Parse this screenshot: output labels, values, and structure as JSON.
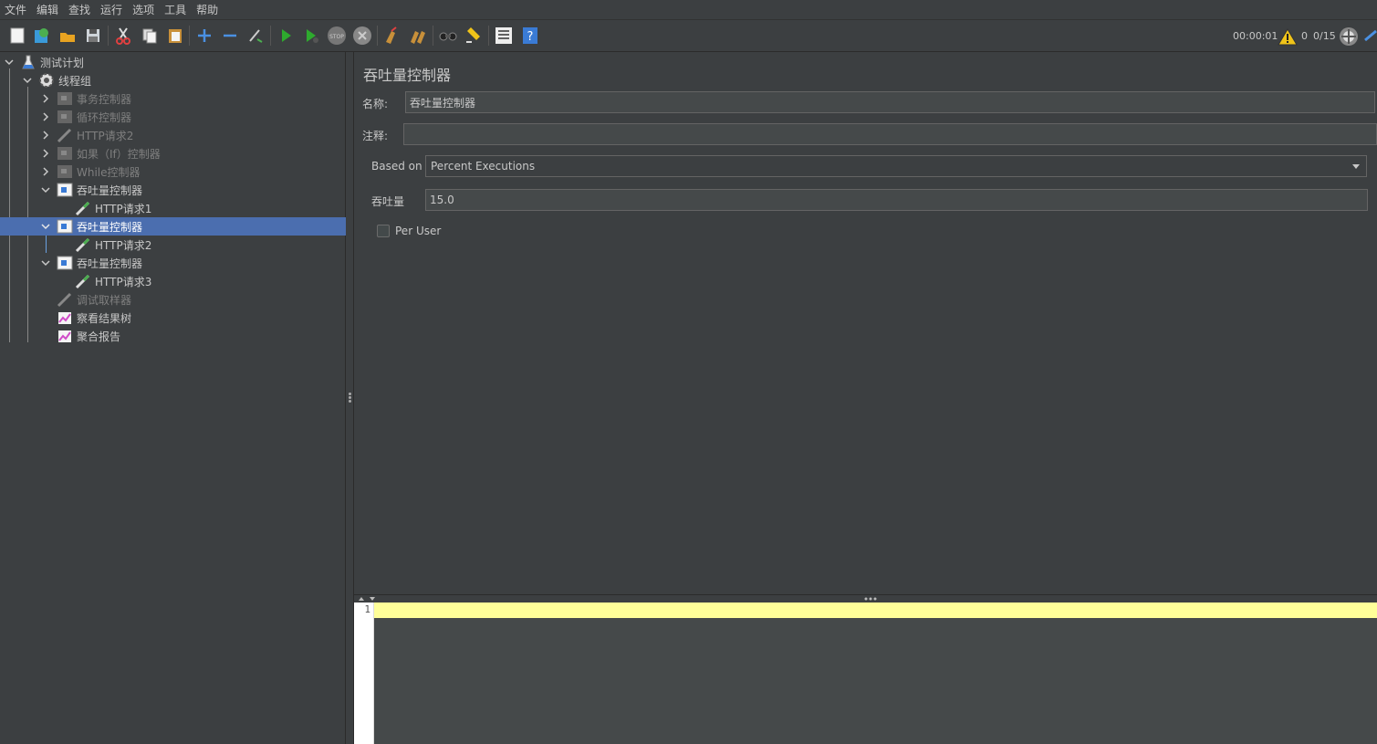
{
  "menu": [
    "文件",
    "编辑",
    "查找",
    "运行",
    "选项",
    "工具",
    "帮助"
  ],
  "status": {
    "elapsed": "00:00:01",
    "warnings": "0",
    "threads": "0/15"
  },
  "tree": [
    {
      "label": "测试计划"
    },
    {
      "label": "线程组"
    },
    {
      "label": "事务控制器"
    },
    {
      "label": "循环控制器"
    },
    {
      "label": "HTTP请求2"
    },
    {
      "label": "如果（If）控制器"
    },
    {
      "label": "While控制器"
    },
    {
      "label": "吞吐量控制器"
    },
    {
      "label": "HTTP请求1"
    },
    {
      "label": "吞吐量控制器"
    },
    {
      "label": "HTTP请求2"
    },
    {
      "label": "吞吐量控制器"
    },
    {
      "label": "HTTP请求3"
    },
    {
      "label": "调试取样器"
    },
    {
      "label": "察看结果树"
    },
    {
      "label": "聚合报告"
    }
  ],
  "panel": {
    "title": "吞吐量控制器",
    "name_label": "名称:",
    "name_value": "吞吐量控制器",
    "comment_label": "注释:",
    "comment_value": "",
    "based_on_label": "Based on",
    "based_on_value": "Percent Executions",
    "throughput_label": "吞吐量",
    "throughput_value": "15.0",
    "per_user_label": "Per User",
    "per_user_checked": false
  },
  "editor": {
    "line": "1"
  },
  "colors": {
    "selection": "#4b6eaf",
    "background": "#3c3f41",
    "current_line": "#ffff99"
  }
}
